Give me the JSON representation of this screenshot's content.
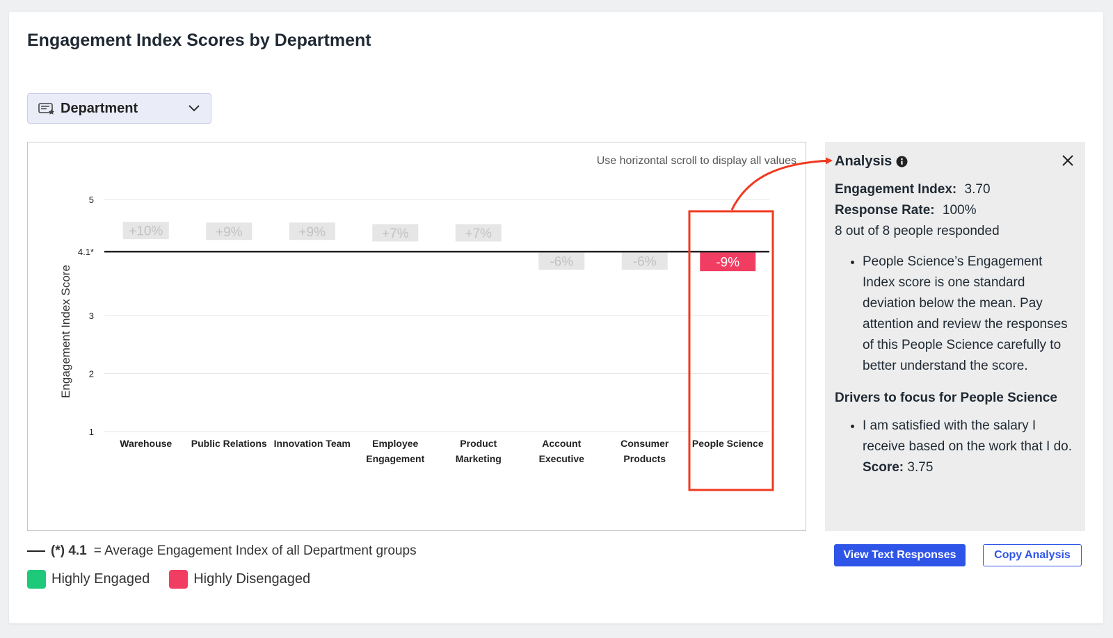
{
  "page": {
    "title": "Engagement Index Scores by Department"
  },
  "filter": {
    "label": "Department",
    "icon": "badge-card-icon",
    "chevron_icon": "chevron-down-icon"
  },
  "chart_hint": "Use horizontal scroll to display all values",
  "chart_data": {
    "type": "bar",
    "ylabel": "Engagement Index Score",
    "xlabel": "",
    "yticks": [
      "1",
      "2",
      "3",
      "4.1*",
      "5"
    ],
    "ylim": [
      1,
      5
    ],
    "average": 4.1,
    "categories": [
      "Warehouse",
      "Public Relations",
      "Innovation Team",
      "Employee Engagement",
      "Product Marketing",
      "Account Executive",
      "Consumer Products",
      "People Science"
    ],
    "category_lines": [
      [
        "Warehouse"
      ],
      [
        "Public Relations"
      ],
      [
        "Innovation Team"
      ],
      [
        "Employee",
        "Engagement"
      ],
      [
        "Product",
        "Marketing"
      ],
      [
        "Account",
        "Executive"
      ],
      [
        "Consumer",
        "Products"
      ],
      [
        "People Science"
      ]
    ],
    "deltas": [
      "+10%",
      "+9%",
      "+9%",
      "+7%",
      "+7%",
      "-6%",
      "-6%",
      "-9%"
    ],
    "delta_values": [
      10,
      9,
      9,
      7,
      7,
      -6,
      -6,
      -9
    ],
    "highlighted_index": 7,
    "grid": true
  },
  "footer": {
    "avg_marker": "(*) 4.1",
    "avg_text": "= Average Engagement Index of all Department groups"
  },
  "legend": [
    {
      "label": "Highly Engaged",
      "color": "#1fc97a"
    },
    {
      "label": "Highly Disengaged",
      "color": "#f23d63"
    }
  ],
  "analysis": {
    "title": "Analysis",
    "info_icon": "info-icon",
    "close_icon": "close-icon",
    "engagement_label": "Engagement Index:",
    "engagement_value": "3.70",
    "response_label": "Response Rate:",
    "response_value": "100%",
    "responded_text": "8 out of 8 people responded",
    "summary_bullet": "People Science’s Engagement Index score is one standard deviation below the mean. Pay attention and review the responses of this People Science carefully to better understand the score.",
    "drivers_title": "Drivers to focus for People Science",
    "driver_text": "I am satisfied with the salary I receive based on the work that I do.",
    "driver_score_label": "Score:",
    "driver_score_value": "3.75"
  },
  "buttons": {
    "view_text": "View Text Responses",
    "copy_analysis": "Copy Analysis"
  },
  "colors": {
    "primary": "#2e54e8",
    "negative": "#f23d63",
    "positive": "#1fc97a",
    "neutral_tag": "#e6e6e6",
    "annotation": "#f0391f"
  }
}
